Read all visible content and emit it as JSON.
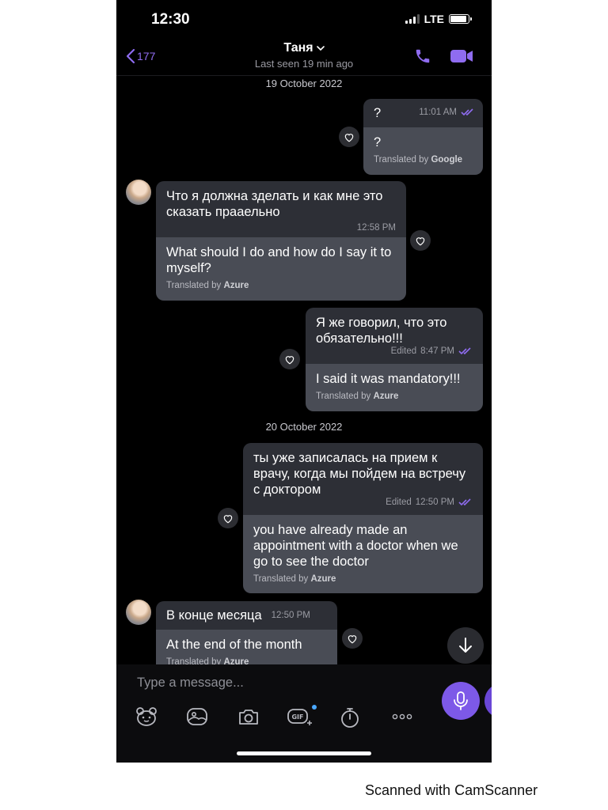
{
  "status_bar": {
    "time": "12:30",
    "network": "LTE",
    "battery_level": 0.9
  },
  "header": {
    "back_count": "177",
    "contact_name": "Таня",
    "last_seen": "Last seen 19 min ago"
  },
  "dates": {
    "first": "19 October 2022",
    "second": "20 October 2022"
  },
  "messages": [
    {
      "side": "outgoing",
      "original": "?",
      "time": "11:01 AM",
      "translation": "?",
      "translated_by_prefix": "Translated by",
      "provider": "Google"
    },
    {
      "side": "incoming",
      "original": "Что я должна зделать и как мне это сказать прааельно",
      "time": "12:58 PM",
      "translation": "What should I do and how do I say it to myself?",
      "translated_by_prefix": "Translated by",
      "provider": "Azure"
    },
    {
      "side": "outgoing",
      "original": "Я же говорил, что это обязательно!!!",
      "edited": "Edited",
      "time": "8:47 PM",
      "translation": "I said it was mandatory!!!",
      "translated_by_prefix": "Translated by",
      "provider": "Azure"
    },
    {
      "side": "outgoing",
      "original": "ты уже записалась на прием к врачу, когда мы пойдем на встречу с доктором",
      "edited": "Edited",
      "time": "12:50 PM",
      "translation": "you have already made an appointment with a doctor when we go to see the doctor",
      "translated_by_prefix": "Translated by",
      "provider": "Azure"
    },
    {
      "side": "incoming",
      "original": "В конце месяца",
      "time": "12:50 PM",
      "translation": "At the end of the month",
      "translated_by_prefix": "Translated by",
      "provider": "Azure"
    }
  ],
  "composer": {
    "placeholder": "Type a message..."
  },
  "toolbar_icons": [
    "sticker-icon",
    "gallery-icon",
    "camera-icon",
    "gif-icon",
    "timer-icon",
    "more-icon"
  ],
  "colors": {
    "accent": "#8f6cf0",
    "incoming_bg": "#2d2f36",
    "translation_bg": "#494c55",
    "mic": "#7d59e8"
  },
  "watermark": "Scanned with CamScanner"
}
